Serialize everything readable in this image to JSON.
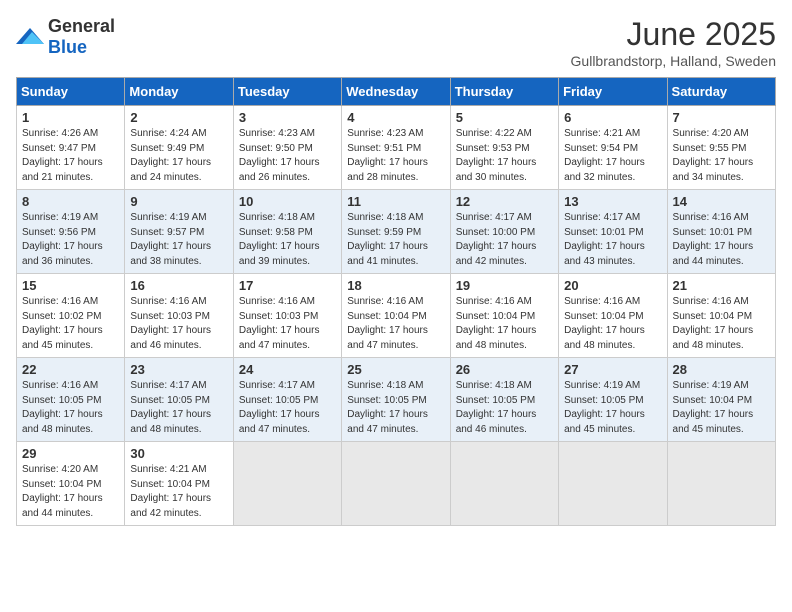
{
  "header": {
    "logo_general": "General",
    "logo_blue": "Blue",
    "title": "June 2025",
    "subtitle": "Gullbrandstorp, Halland, Sweden"
  },
  "weekdays": [
    "Sunday",
    "Monday",
    "Tuesday",
    "Wednesday",
    "Thursday",
    "Friday",
    "Saturday"
  ],
  "weeks": [
    [
      {
        "day": "1",
        "rise": "4:26 AM",
        "set": "9:47 PM",
        "daylight": "17 hours and 21 minutes."
      },
      {
        "day": "2",
        "rise": "4:24 AM",
        "set": "9:49 PM",
        "daylight": "17 hours and 24 minutes."
      },
      {
        "day": "3",
        "rise": "4:23 AM",
        "set": "9:50 PM",
        "daylight": "17 hours and 26 minutes."
      },
      {
        "day": "4",
        "rise": "4:23 AM",
        "set": "9:51 PM",
        "daylight": "17 hours and 28 minutes."
      },
      {
        "day": "5",
        "rise": "4:22 AM",
        "set": "9:53 PM",
        "daylight": "17 hours and 30 minutes."
      },
      {
        "day": "6",
        "rise": "4:21 AM",
        "set": "9:54 PM",
        "daylight": "17 hours and 32 minutes."
      },
      {
        "day": "7",
        "rise": "4:20 AM",
        "set": "9:55 PM",
        "daylight": "17 hours and 34 minutes."
      }
    ],
    [
      {
        "day": "8",
        "rise": "4:19 AM",
        "set": "9:56 PM",
        "daylight": "17 hours and 36 minutes."
      },
      {
        "day": "9",
        "rise": "4:19 AM",
        "set": "9:57 PM",
        "daylight": "17 hours and 38 minutes."
      },
      {
        "day": "10",
        "rise": "4:18 AM",
        "set": "9:58 PM",
        "daylight": "17 hours and 39 minutes."
      },
      {
        "day": "11",
        "rise": "4:18 AM",
        "set": "9:59 PM",
        "daylight": "17 hours and 41 minutes."
      },
      {
        "day": "12",
        "rise": "4:17 AM",
        "set": "10:00 PM",
        "daylight": "17 hours and 42 minutes."
      },
      {
        "day": "13",
        "rise": "4:17 AM",
        "set": "10:01 PM",
        "daylight": "17 hours and 43 minutes."
      },
      {
        "day": "14",
        "rise": "4:16 AM",
        "set": "10:01 PM",
        "daylight": "17 hours and 44 minutes."
      }
    ],
    [
      {
        "day": "15",
        "rise": "4:16 AM",
        "set": "10:02 PM",
        "daylight": "17 hours and 45 minutes."
      },
      {
        "day": "16",
        "rise": "4:16 AM",
        "set": "10:03 PM",
        "daylight": "17 hours and 46 minutes."
      },
      {
        "day": "17",
        "rise": "4:16 AM",
        "set": "10:03 PM",
        "daylight": "17 hours and 47 minutes."
      },
      {
        "day": "18",
        "rise": "4:16 AM",
        "set": "10:04 PM",
        "daylight": "17 hours and 47 minutes."
      },
      {
        "day": "19",
        "rise": "4:16 AM",
        "set": "10:04 PM",
        "daylight": "17 hours and 48 minutes."
      },
      {
        "day": "20",
        "rise": "4:16 AM",
        "set": "10:04 PM",
        "daylight": "17 hours and 48 minutes."
      },
      {
        "day": "21",
        "rise": "4:16 AM",
        "set": "10:04 PM",
        "daylight": "17 hours and 48 minutes."
      }
    ],
    [
      {
        "day": "22",
        "rise": "4:16 AM",
        "set": "10:05 PM",
        "daylight": "17 hours and 48 minutes."
      },
      {
        "day": "23",
        "rise": "4:17 AM",
        "set": "10:05 PM",
        "daylight": "17 hours and 48 minutes."
      },
      {
        "day": "24",
        "rise": "4:17 AM",
        "set": "10:05 PM",
        "daylight": "17 hours and 47 minutes."
      },
      {
        "day": "25",
        "rise": "4:18 AM",
        "set": "10:05 PM",
        "daylight": "17 hours and 47 minutes."
      },
      {
        "day": "26",
        "rise": "4:18 AM",
        "set": "10:05 PM",
        "daylight": "17 hours and 46 minutes."
      },
      {
        "day": "27",
        "rise": "4:19 AM",
        "set": "10:05 PM",
        "daylight": "17 hours and 45 minutes."
      },
      {
        "day": "28",
        "rise": "4:19 AM",
        "set": "10:04 PM",
        "daylight": "17 hours and 45 minutes."
      }
    ],
    [
      {
        "day": "29",
        "rise": "4:20 AM",
        "set": "10:04 PM",
        "daylight": "17 hours and 44 minutes."
      },
      {
        "day": "30",
        "rise": "4:21 AM",
        "set": "10:04 PM",
        "daylight": "17 hours and 42 minutes."
      },
      null,
      null,
      null,
      null,
      null
    ]
  ],
  "labels": {
    "sunrise": "Sunrise:",
    "sunset": "Sunset:",
    "daylight": "Daylight:"
  }
}
